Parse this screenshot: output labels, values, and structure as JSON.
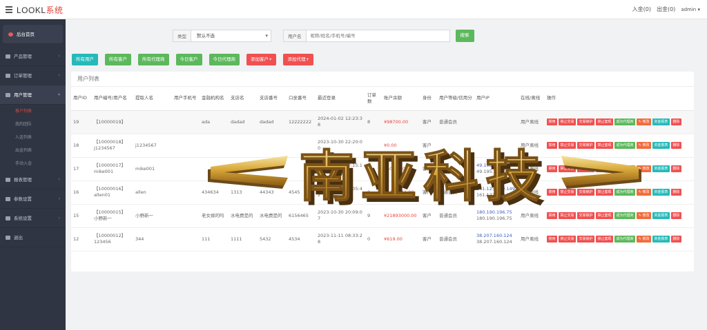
{
  "brand": {
    "name": "LOOKL",
    "accent": "系统"
  },
  "topbar": {
    "deposit": "入金(0)",
    "withdraw": "出金(0)",
    "user": "admin"
  },
  "sidebar": {
    "home": "后台首页",
    "items": [
      {
        "label": "产品管理",
        "icon": "product-icon"
      },
      {
        "label": "订单管理",
        "icon": "order-icon"
      },
      {
        "label": "用户管理",
        "icon": "user-icon",
        "active": true
      }
    ],
    "subitems": [
      "客户列表",
      "我的团队",
      "入金列表",
      "出金列表",
      "手动入金"
    ],
    "items_after": [
      {
        "label": "报表管理",
        "icon": "report-icon"
      },
      {
        "label": "参数设置",
        "icon": "params-icon"
      },
      {
        "label": "系统设置",
        "icon": "system-icon"
      },
      {
        "label": "退出",
        "icon": "logout-icon"
      }
    ]
  },
  "filter": {
    "type_label": "类型",
    "type_value": "默认不选",
    "user_label": "用户名",
    "user_placeholder": "昵称/姓名/手机号/编号",
    "search": "搜索"
  },
  "tabs": [
    {
      "label": "所有用户",
      "color": "#26b9b9"
    },
    {
      "label": "所有客户",
      "color": "#5cb85c"
    },
    {
      "label": "所有代理商",
      "color": "#5cb85c"
    },
    {
      "label": "今日客户",
      "color": "#5cb85c"
    },
    {
      "label": "今日代理商",
      "color": "#5cb85c"
    },
    {
      "label": "添加客户+",
      "color": "#f05050"
    },
    {
      "label": "添加代理+",
      "color": "#f05050"
    }
  ],
  "panel_title": "用户列表",
  "table": {
    "headers": [
      "用户ID",
      "用户编号/用户名",
      "提取人名",
      "用户手机号",
      "金融机构名",
      "支店名",
      "支店番号",
      "口坐番号",
      "最近登录",
      "订单数",
      "账户余额",
      "身份",
      "用户等级/信用分",
      "用户IP",
      "在线/离线",
      "操作"
    ],
    "rows": [
      {
        "id": "19",
        "code": "【10000019】",
        "name": "",
        "holder": "",
        "phone": "",
        "bank": "ada",
        "branch": "dadad",
        "branch_no": "dadad",
        "account": "12222222",
        "login": "2024-01-02 12:23:38",
        "orders": "8",
        "balance": "¥98700.00",
        "role": "客户",
        "level": "普通会员",
        "ip1": "",
        "ip2": "",
        "online": "用户离线"
      },
      {
        "id": "18",
        "code": "【10000018】",
        "name": "j1234567",
        "holder": "j1234567",
        "phone": "",
        "bank": "",
        "branch": "",
        "branch_no": "",
        "account": "",
        "login": "2023-10-30 22:20:00",
        "orders": "",
        "balance": "¥0.00",
        "role": "客户",
        "level": "",
        "ip1": "",
        "ip2": "",
        "online": "用户离线"
      },
      {
        "id": "17",
        "code": "【10000017】",
        "name": "mike001",
        "holder": "mike001",
        "phone": "",
        "bank": "",
        "branch": "",
        "branch_no": "",
        "account": "",
        "login": "2023-10-30 22:15:12",
        "orders": "",
        "balance": "¥5000.00",
        "role": "客户",
        "level": "",
        "ip1": "49.195.192.34",
        "ip2": "49.195.192.34",
        "online": "用户离线"
      },
      {
        "id": "16",
        "code": "【10000016】",
        "name": "allen01",
        "holder": "allen",
        "phone": "",
        "bank": "434634",
        "branch": "1313",
        "branch_no": "44343",
        "account": "4545",
        "login": "2023-10-31 21:05:42",
        "orders": "0",
        "balance": "¥1111911.00",
        "role": "客户",
        "level": "普通会员",
        "ip1": "161.123.209.149",
        "ip2": "161.123.209.149",
        "online": "用户离线"
      },
      {
        "id": "15",
        "code": "【10000015】",
        "name": "小野新一",
        "holder": "小野新一",
        "phone": "",
        "bank": "老女嫁的吗",
        "branch": "水电费是的",
        "branch_no": "水电费是的",
        "account": "6156465",
        "login": "2023-10-30 20:09:07",
        "orders": "9",
        "balance": "¥21893000.00",
        "role": "客户",
        "level": "普通会员",
        "ip1": "180.190.196.75",
        "ip2": "180.190.196.75",
        "online": "用户离线"
      },
      {
        "id": "12",
        "code": "【10000012】",
        "name": "123456",
        "holder": "344",
        "phone": "",
        "bank": "111",
        "branch": "1111",
        "branch_no": "5432",
        "account": "4534",
        "login": "2023-11-11 08:33:28",
        "orders": "0",
        "balance": "¥619.00",
        "role": "客户",
        "level": "普通会员",
        "ip1": "38.207.160.124",
        "ip2": "38.207.160.124",
        "online": "用户离线"
      }
    ],
    "actions": [
      {
        "label": "禁用",
        "style": "red"
      },
      {
        "label": "禁止交易",
        "style": "red"
      },
      {
        "label": "交易锁护",
        "style": "red"
      },
      {
        "label": "禁止套现",
        "style": "red"
      },
      {
        "label": "成为代理商",
        "style": "green"
      },
      {
        "label": "✎ 修改",
        "style": "orange"
      },
      {
        "label": "资金报表",
        "style": "teal"
      },
      {
        "label": "删除",
        "style": "red"
      }
    ]
  },
  "watermark": {
    "text": "南亚科技"
  }
}
